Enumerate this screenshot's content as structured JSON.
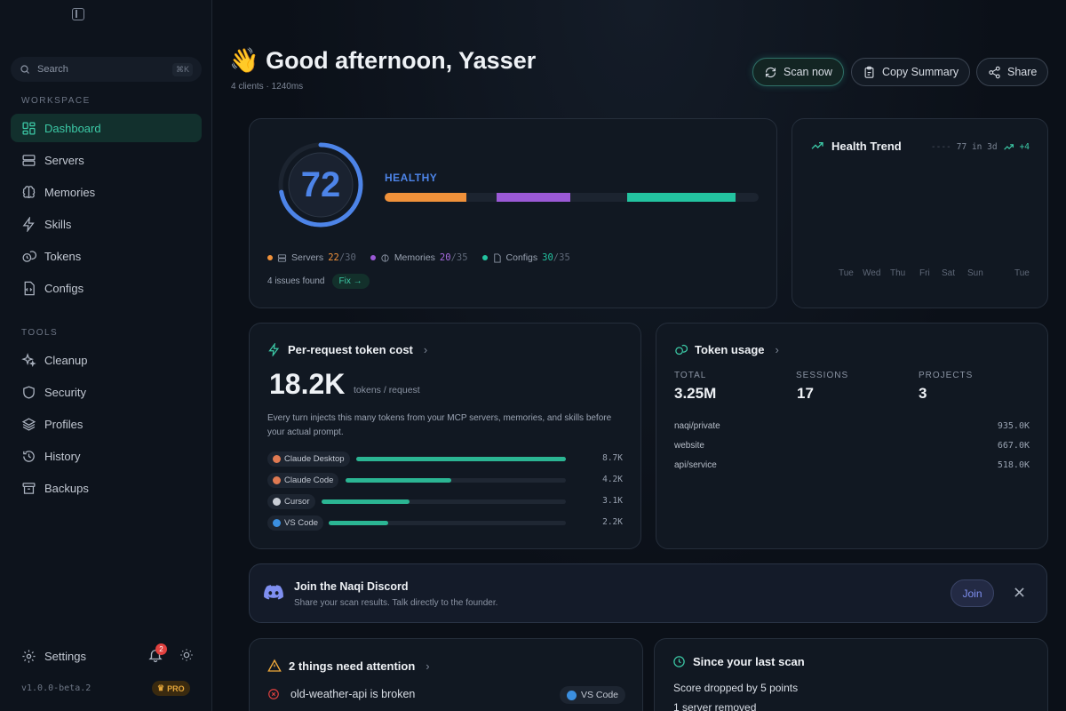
{
  "sidebar": {
    "search": {
      "label": "Search",
      "shortcut": "⌘K"
    },
    "workspace_label": "WORKSPACE",
    "workspace_items": [
      {
        "label": "Dashboard",
        "icon": "dashboard-icon",
        "active": true
      },
      {
        "label": "Servers",
        "icon": "server-icon"
      },
      {
        "label": "Memories",
        "icon": "brain-icon"
      },
      {
        "label": "Skills",
        "icon": "lightning-icon"
      },
      {
        "label": "Tokens",
        "icon": "coins-icon"
      },
      {
        "label": "Configs",
        "icon": "file-code-icon"
      }
    ],
    "tools_label": "TOOLS",
    "tools_items": [
      {
        "label": "Cleanup",
        "icon": "sparkles-icon"
      },
      {
        "label": "Security",
        "icon": "shield-icon"
      },
      {
        "label": "Profiles",
        "icon": "layers-icon"
      },
      {
        "label": "History",
        "icon": "history-icon"
      },
      {
        "label": "Backups",
        "icon": "archive-icon"
      }
    ],
    "settings_label": "Settings",
    "notification_count": "2",
    "version": "v1.0.0-beta.2",
    "pro_label": "PRO"
  },
  "header": {
    "wave": "👋",
    "greeting": "Good afternoon, Yasser",
    "subline": "4 clients · 1240ms",
    "scan_label": "Scan now",
    "copy_label": "Copy Summary",
    "share_label": "Share"
  },
  "health": {
    "score": "72",
    "score_value": 72,
    "status": "HEALTHY",
    "segments": [
      {
        "name": "Servers",
        "value": "22",
        "total": "/30",
        "color": "#f0913a"
      },
      {
        "name": "Memories",
        "value": "20",
        "total": "/35",
        "color": "#9b59d6"
      },
      {
        "name": "Configs",
        "value": "30",
        "total": "/35",
        "color": "#23c3a0"
      }
    ],
    "issues": "4 issues found",
    "fix_label": "Fix →"
  },
  "trend": {
    "title": "Health Trend",
    "meta": "77 in 3d",
    "delta": "+4",
    "days": [
      "Tue",
      "Wed",
      "Thu",
      "Fri",
      "Sat",
      "Sun",
      "Tue"
    ]
  },
  "token_cost": {
    "title": "Per-request token cost",
    "value": "18.2K",
    "unit": "tokens / request",
    "description": "Every turn injects this many tokens from your MCP servers, memories, and skills before your actual prompt.",
    "clients": [
      {
        "name": "Claude Desktop",
        "value": "8.7K",
        "fraction": 1.0,
        "color": "#e07a52"
      },
      {
        "name": "Claude Code",
        "value": "4.2K",
        "fraction": 0.48,
        "color": "#e07a52"
      },
      {
        "name": "Cursor",
        "value": "3.1K",
        "fraction": 0.36,
        "color": "#c9ced6"
      },
      {
        "name": "VS Code",
        "value": "2.2K",
        "fraction": 0.25,
        "color": "#3b8fe0"
      }
    ]
  },
  "token_usage": {
    "title": "Token usage",
    "stats": [
      {
        "label": "TOTAL",
        "value": "3.25M"
      },
      {
        "label": "SESSIONS",
        "value": "17"
      },
      {
        "label": "PROJECTS",
        "value": "3"
      }
    ],
    "projects": [
      {
        "name": "naqi/private",
        "value": "935.0K"
      },
      {
        "name": "website",
        "value": "667.0K"
      },
      {
        "name": "api/service",
        "value": "518.0K"
      }
    ]
  },
  "discord": {
    "title": "Join the Naqi Discord",
    "subtitle": "Share your scan results. Talk directly to the founder.",
    "join_label": "Join"
  },
  "attention": {
    "title": "2 things need attention",
    "item": "old-weather-api is broken",
    "item_tag": "VS Code"
  },
  "since": {
    "title": "Since your last scan",
    "line1": "Score dropped by 5 points",
    "line2": "1 server removed"
  }
}
